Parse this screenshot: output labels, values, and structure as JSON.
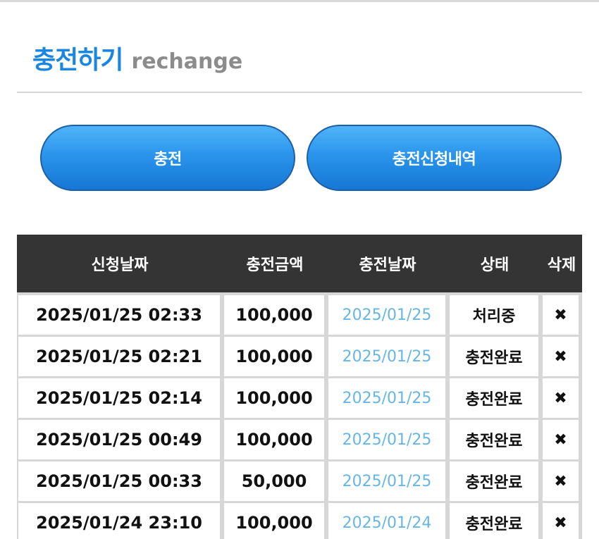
{
  "header": {
    "title": "충전하기",
    "subtitle": "rechange"
  },
  "buttons": {
    "charge": "충전",
    "history": "충전신청내역"
  },
  "table": {
    "columns": [
      "신청날짜",
      "충전금액",
      "충전날짜",
      "상태",
      "삭제"
    ],
    "rows": [
      {
        "request_date": "2025/01/25 02:33",
        "amount": "100,000",
        "charge_date": "2025/01/25",
        "status": "처리중",
        "delete": "✖"
      },
      {
        "request_date": "2025/01/25 02:21",
        "amount": "100,000",
        "charge_date": "2025/01/25",
        "status": "충전완료",
        "delete": "✖"
      },
      {
        "request_date": "2025/01/25 02:14",
        "amount": "100,000",
        "charge_date": "2025/01/25",
        "status": "충전완료",
        "delete": "✖"
      },
      {
        "request_date": "2025/01/25 00:49",
        "amount": "100,000",
        "charge_date": "2025/01/25",
        "status": "충전완료",
        "delete": "✖"
      },
      {
        "request_date": "2025/01/25 00:33",
        "amount": "50,000",
        "charge_date": "2025/01/25",
        "status": "충전완료",
        "delete": "✖"
      },
      {
        "request_date": "2025/01/24 23:10",
        "amount": "100,000",
        "charge_date": "2025/01/24",
        "status": "충전완료",
        "delete": "✖"
      }
    ]
  },
  "colors": {
    "accent": "#1a86e0",
    "button": "#2a95ec",
    "header_bg": "#343434",
    "date_text": "#66b6e6"
  }
}
